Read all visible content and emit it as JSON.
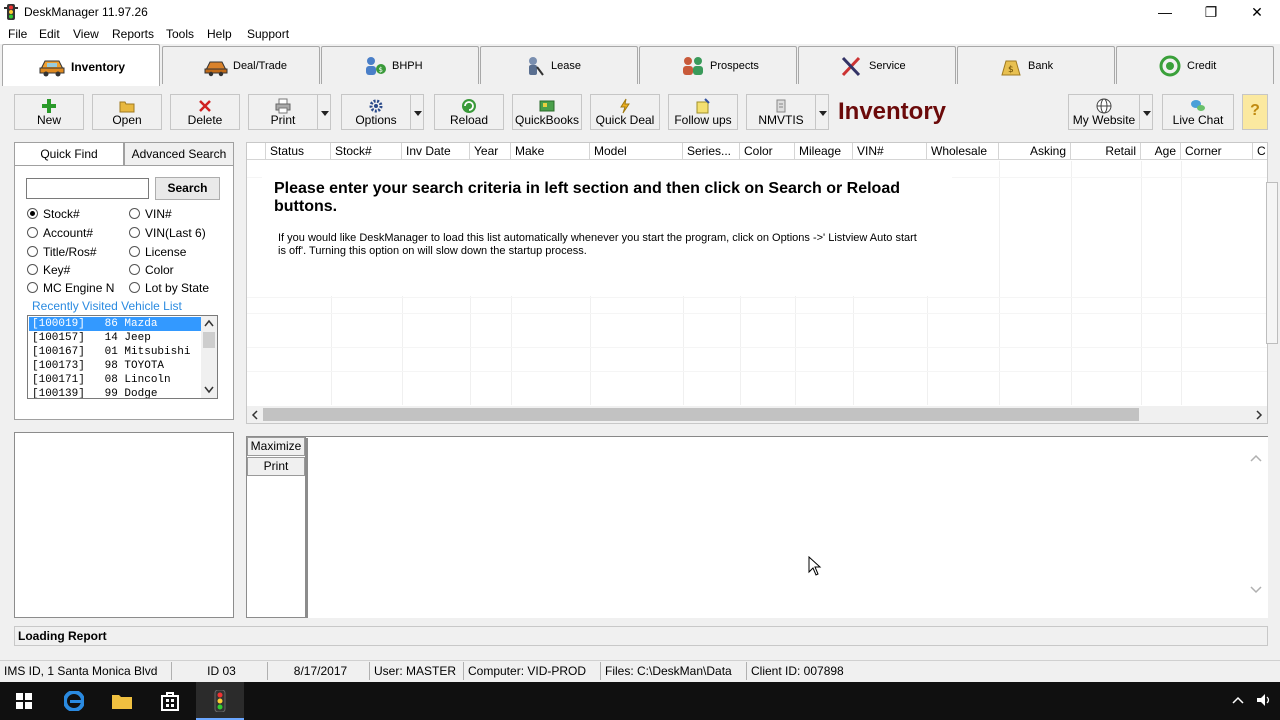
{
  "window": {
    "title": "DeskManager 11.97.26",
    "controls": {
      "minimize": "—",
      "restore": "❐",
      "close": "✕"
    }
  },
  "menu": [
    "File",
    "Edit",
    "View",
    "Reports",
    "Tools",
    "Help",
    "Support"
  ],
  "tabs": [
    {
      "label": "Inventory",
      "icon": "car-icon",
      "active": true
    },
    {
      "label": "Deal/Trade",
      "icon": "car-trade-icon"
    },
    {
      "label": "BHPH",
      "icon": "people-money-icon"
    },
    {
      "label": "Lease",
      "icon": "lease-icon"
    },
    {
      "label": "Prospects",
      "icon": "prospects-icon"
    },
    {
      "label": "Service",
      "icon": "tools-icon"
    },
    {
      "label": "Bank",
      "icon": "money-bag-icon"
    },
    {
      "label": "Credit",
      "icon": "credit-gauge-icon"
    }
  ],
  "toolbar": {
    "new": "New",
    "open": "Open",
    "delete": "Delete",
    "print": "Print",
    "options": "Options",
    "reload": "Reload",
    "quickbooks": "QuickBooks",
    "quick_deal": "Quick Deal",
    "follow_ups": "Follow ups",
    "nmvtis": "NMVTIS",
    "heading": "Inventory",
    "my_website": "My Website",
    "live_chat": "Live Chat",
    "help": "?"
  },
  "search": {
    "tabs": {
      "quick_find": "Quick Find",
      "advanced": "Advanced Search"
    },
    "input_value": "",
    "button": "Search",
    "options": [
      {
        "label": "Stock#",
        "selected": true
      },
      {
        "label": "VIN#",
        "selected": false
      },
      {
        "label": "Account#",
        "selected": false
      },
      {
        "label": "VIN(Last 6)",
        "selected": false
      },
      {
        "label": "Title/Ros#",
        "selected": false
      },
      {
        "label": "License",
        "selected": false
      },
      {
        "label": "Key#",
        "selected": false
      },
      {
        "label": "Color",
        "selected": false
      },
      {
        "label": "MC Engine N",
        "selected": false
      },
      {
        "label": "Lot by State",
        "selected": false
      }
    ],
    "recent_title": "Recently Visited Vehicle List",
    "recent": [
      "[100019]   86 Mazda",
      "[100157]   14 Jeep",
      "[100167]   01 Mitsubishi",
      "[100173]   98 TOYOTA",
      "[100171]   08 Lincoln",
      "[100139]   99 Dodge"
    ]
  },
  "grid": {
    "columns": [
      "",
      "Status",
      "Stock#",
      "Inv Date",
      "Year",
      "Make",
      "Model",
      "Series...",
      "Color",
      "Mileage",
      "VIN#",
      "Wholesale",
      "Asking",
      "Retail",
      "Age",
      "Corner",
      "C"
    ],
    "message_main": "Please enter your search criteria in left section and then click on Search or Reload buttons.",
    "message_sub": "If you would like DeskManager to load this list automatically whenever you start the program, click on Options ->' Listview Auto start is off'. Turning this option on will slow down the startup process."
  },
  "report": {
    "maximize": "Maximize",
    "print": "Print"
  },
  "status": {
    "loading": "Loading Report",
    "cells": [
      "IMS ID, 1 Santa Monica Blvd",
      "ID 03",
      "8/17/2017",
      "User: MASTER",
      "Computer: VID-PROD",
      "Files: C:\\DeskMan\\Data",
      "Client ID: 007898"
    ]
  },
  "taskbar": [
    "windows-start-icon",
    "edge-icon",
    "file-explorer-icon",
    "store-icon",
    "deskmanager-icon"
  ]
}
